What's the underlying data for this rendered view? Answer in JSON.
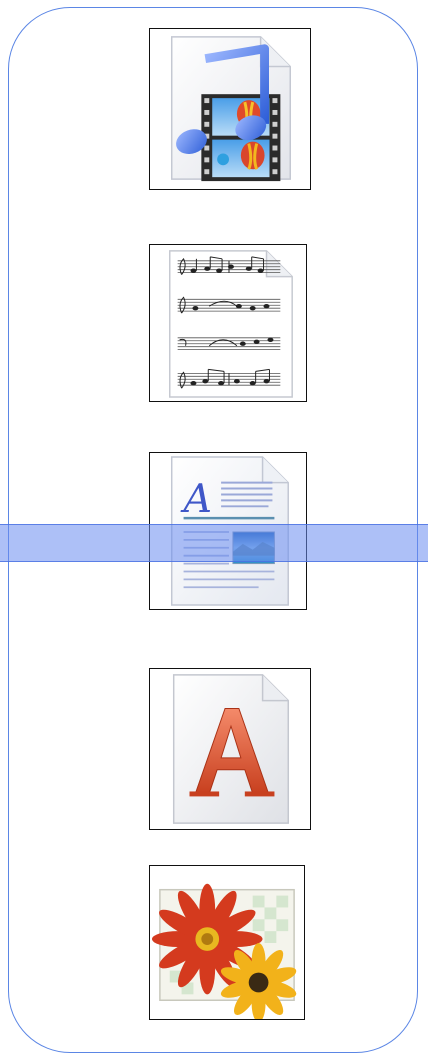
{
  "colors": {
    "panel_border": "#5b86e5",
    "highlight": "#6a8cf0"
  },
  "icons": [
    {
      "name": "media-file-icon",
      "kind": "music-video-document"
    },
    {
      "name": "sheet-music-file-icon",
      "kind": "score-document"
    },
    {
      "name": "rich-text-document-icon",
      "kind": "text-with-image-document"
    },
    {
      "name": "font-file-icon",
      "kind": "font-document"
    },
    {
      "name": "image-file-icon",
      "kind": "photo-document"
    }
  ]
}
